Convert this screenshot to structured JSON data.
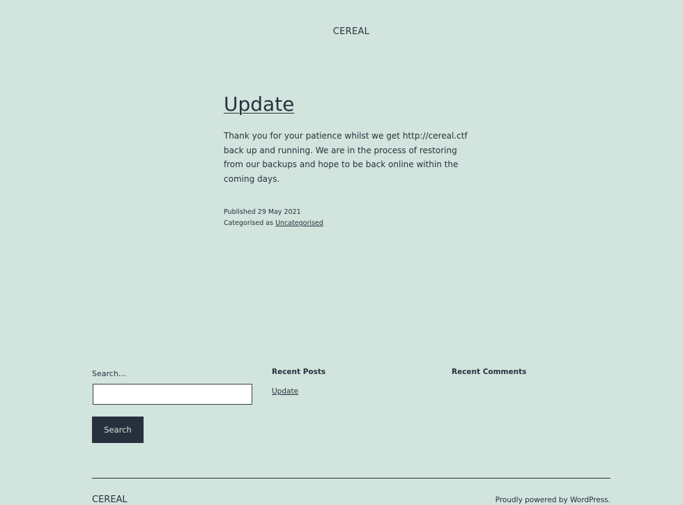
{
  "header": {
    "site_title": "CEREAL"
  },
  "post": {
    "title": "Update",
    "body": "Thank you for your patience whilst we get http://cereal.ctf back up and running. We are in the process of restoring from our backups and hope to be back online within the coming days.",
    "published_label": "Published",
    "published_date": "29 May 2021",
    "categorised_label": "Categorised as",
    "category": "Uncategorised"
  },
  "widgets": {
    "search": {
      "label": "Search…",
      "value": "",
      "button_label": "Search"
    },
    "recent_posts": {
      "heading": "Recent Posts",
      "items": [
        "Update"
      ]
    },
    "recent_comments": {
      "heading": "Recent Comments"
    }
  },
  "footer": {
    "site_title": "CEREAL",
    "powered_prefix": "Proudly powered by",
    "powered_link": "WordPress",
    "powered_suffix": "."
  },
  "colors": {
    "background": "#d1e4dd",
    "text": "#28303d",
    "button_bg": "#28303d"
  }
}
